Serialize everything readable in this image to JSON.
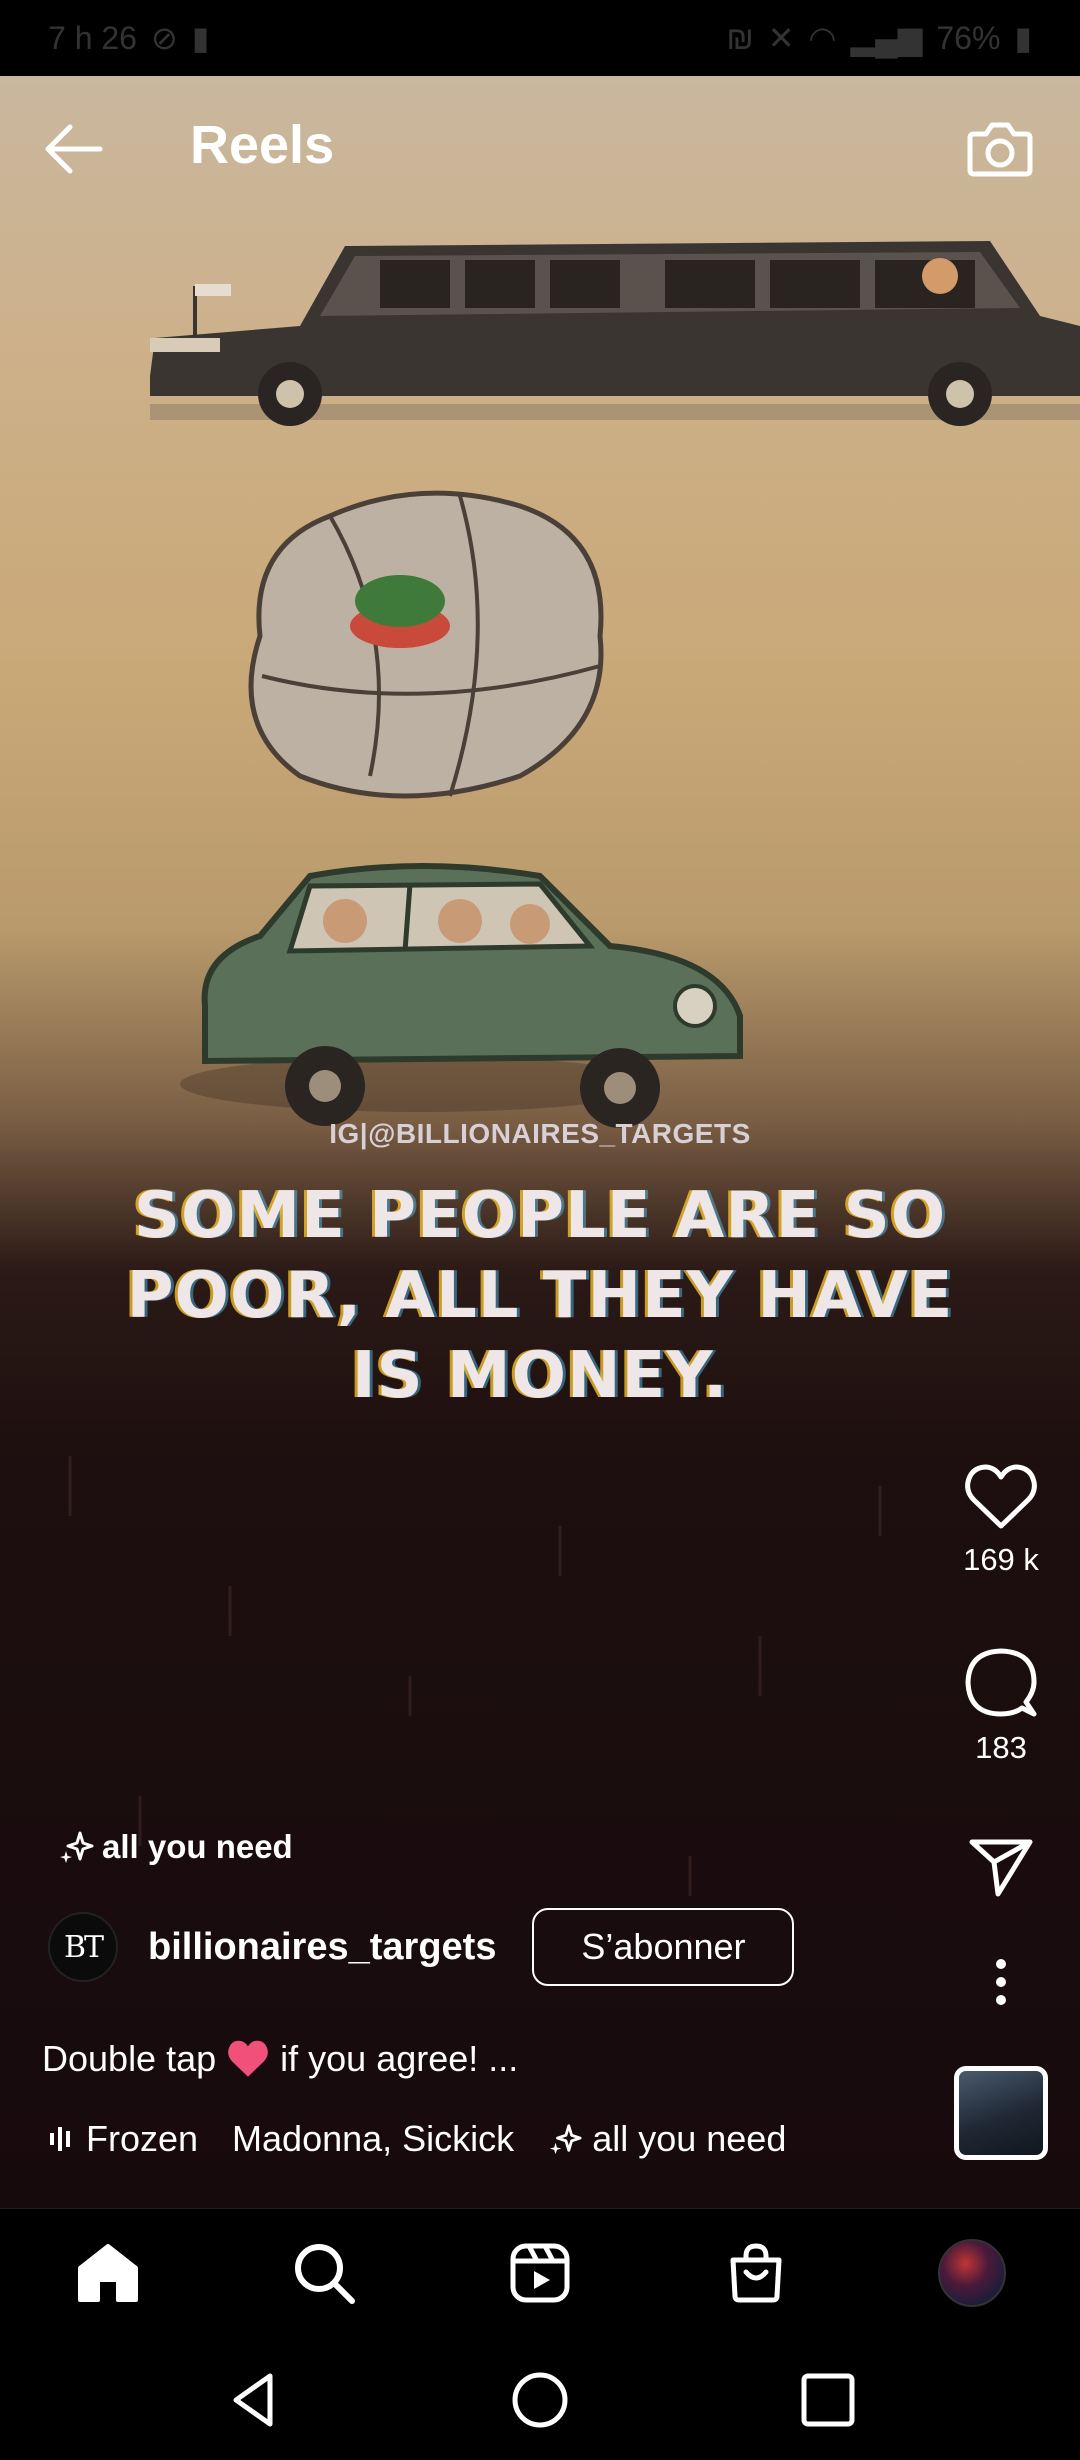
{
  "status_bar": {
    "time": "7 h 26",
    "battery": "76%"
  },
  "header": {
    "title": "Reels"
  },
  "reel": {
    "watermark": "IG|@BILLIONAIRES_TARGETS",
    "quote_lines": [
      "SOME PEOPLE ARE SO",
      "POOR, ALL THEY HAVE",
      "IS MONEY."
    ]
  },
  "actions": {
    "likes": "169 k",
    "comments": "183"
  },
  "effect_top": {
    "label": "all you need"
  },
  "account": {
    "avatar_text": "BT",
    "username": "billionaires_targets",
    "follow_label": "S’abonner"
  },
  "caption": {
    "before": "Double tap",
    "after": "if you agree! ..."
  },
  "music": {
    "song": "Frozen",
    "artists": "Madonna, Sickick",
    "effect": "all you need"
  },
  "colors": {
    "heart": "#f0507a",
    "background": "#000000",
    "text": "#ffffff"
  },
  "icons": [
    "back-arrow-icon",
    "camera-icon",
    "heart-icon",
    "comment-icon",
    "share-icon",
    "more-icon",
    "sparkle-icon",
    "audio-bars-icon",
    "home-icon",
    "search-icon",
    "reels-icon",
    "shop-icon",
    "android-back-icon",
    "android-home-icon",
    "android-recents-icon"
  ]
}
